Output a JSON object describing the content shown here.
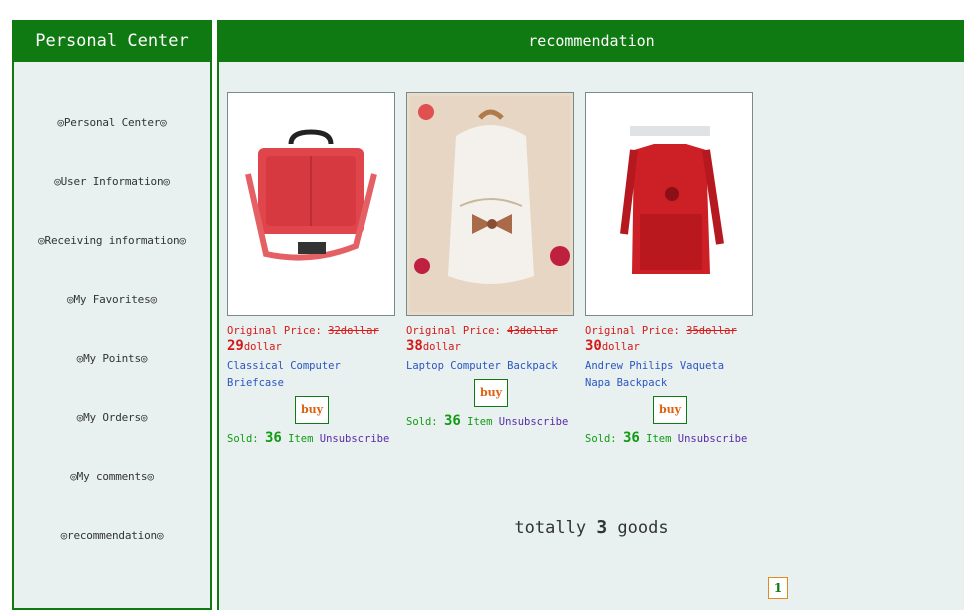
{
  "sidebar": {
    "title": "Personal Center",
    "items": [
      {
        "label": "◎Personal Center◎"
      },
      {
        "label": "◎User Information◎"
      },
      {
        "label": "◎Receiving information◎"
      },
      {
        "label": "◎My Favorites◎"
      },
      {
        "label": "◎My Points◎"
      },
      {
        "label": "◎My Orders◎"
      },
      {
        "label": "◎My comments◎"
      },
      {
        "label": "◎recommendation◎"
      }
    ]
  },
  "main": {
    "title": "recommendation",
    "original_price_label": "Original Price:",
    "buy_label": "buy",
    "sold_label": "Sold:",
    "item_label": "Item",
    "unsubscribe_label": "Unsubscribe",
    "products": [
      {
        "original": "32dollar",
        "price_num": "29",
        "price_unit": "dollar",
        "name": "Classical Computer Briefcase",
        "sold": "36"
      },
      {
        "original": "43dollar",
        "price_num": "38",
        "price_unit": "dollar",
        "name": "Laptop Computer Backpack",
        "sold": "36"
      },
      {
        "original": "35dollar",
        "price_num": "30",
        "price_unit": "dollar",
        "name": "Andrew Philips Vaqueta Napa Backpack",
        "sold": "36"
      }
    ],
    "total_prefix": "totally",
    "total_count": "3",
    "total_suffix": "goods",
    "page": "1"
  },
  "colors": {
    "header_green": "#0f7a12",
    "panel_bg": "#e8f1ef",
    "price_red": "#d61818",
    "link_blue": "#2b55c2"
  }
}
